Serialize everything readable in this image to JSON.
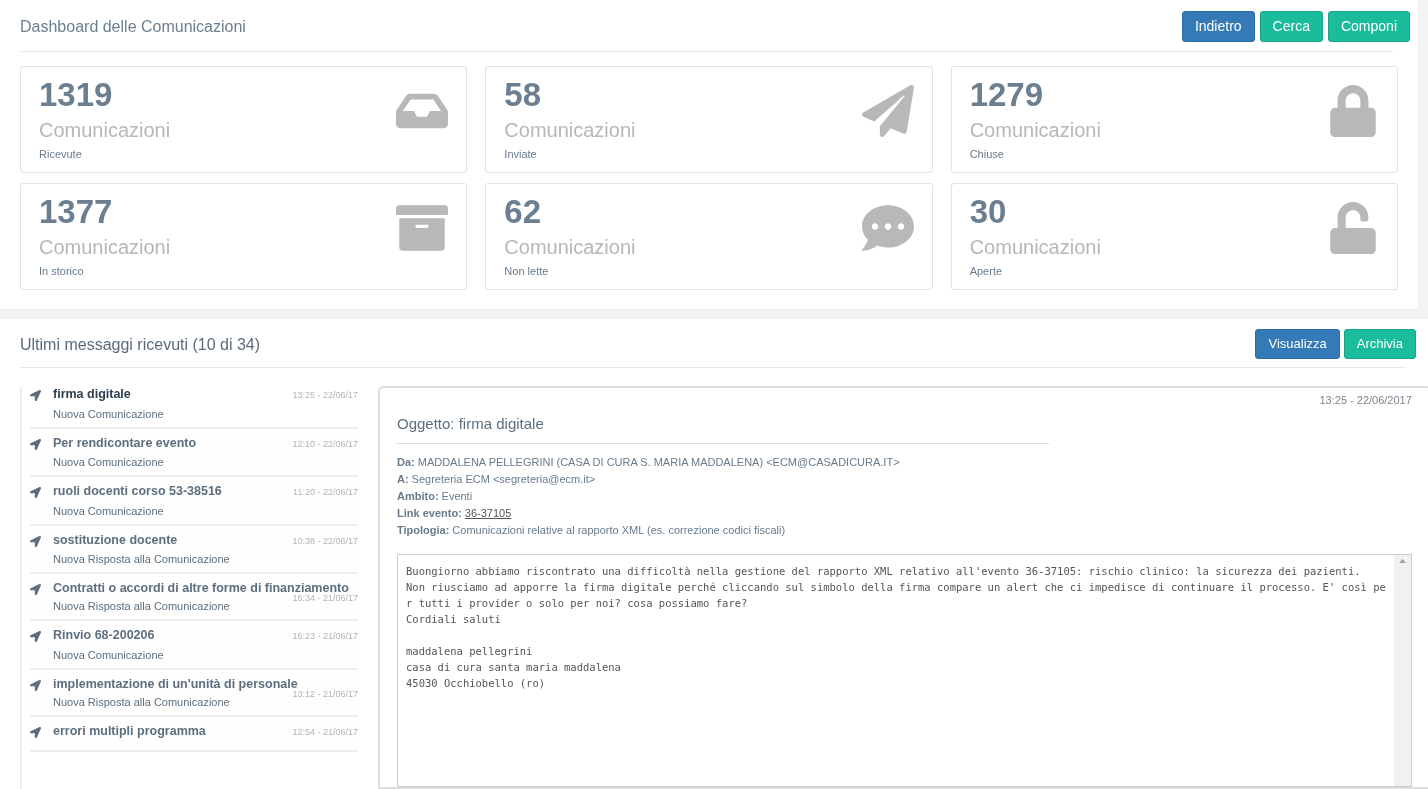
{
  "dashboard": {
    "title": "Dashboard delle Comunicazioni",
    "buttons": [
      {
        "label": "Indietro",
        "kind": "primary"
      },
      {
        "label": "Cerca",
        "kind": "success"
      },
      {
        "label": "Componi",
        "kind": "success"
      }
    ],
    "stats": [
      {
        "count": "1319",
        "label": "Comunicazioni",
        "caption": "Ricevute",
        "kind": "inbox"
      },
      {
        "count": "58",
        "label": "Comunicazioni",
        "caption": "Inviate",
        "kind": "sent"
      },
      {
        "count": "1279",
        "label": "Comunicazioni",
        "caption": "Chiuse",
        "kind": "closed"
      },
      {
        "count": "1377",
        "label": "Comunicazioni",
        "caption": "In storico",
        "kind": "archive"
      },
      {
        "count": "62",
        "label": "Comunicazioni",
        "caption": "Non lette",
        "kind": "unread"
      },
      {
        "count": "30",
        "label": "Comunicazioni",
        "caption": "Aperte",
        "kind": "open"
      }
    ]
  },
  "messages": {
    "title": "Ultimi messaggi ricevuti (10 di 34)",
    "buttons": [
      {
        "label": "Visualizza",
        "kind": "primary"
      },
      {
        "label": "Archivia",
        "kind": "success"
      }
    ],
    "items": [
      {
        "subject": "firma digitale",
        "type": "Nuova Comunicazione",
        "time": "13:25 - 22/06/17",
        "selected": true
      },
      {
        "subject": "Per rendicontare evento",
        "type": "Nuova Comunicazione",
        "time": "12:10 - 22/06/17",
        "selected": false
      },
      {
        "subject": "ruoli docenti corso 53-38516",
        "type": "Nuova Comunicazione",
        "time": "11:20 - 22/06/17",
        "selected": false
      },
      {
        "subject": "sostituzione docente",
        "type": "Nuova Risposta alla Comunicazione",
        "time": "10:38 - 22/06/17",
        "selected": false
      },
      {
        "subject": "Contratti o accordi di altre forme di finanziamento",
        "type": "Nuova Risposta alla Comunicazione",
        "time": "16:34 - 21/06/17",
        "selected": false
      },
      {
        "subject": "Rinvio 68-200206",
        "type": "Nuova Comunicazione",
        "time": "16:23 - 21/06/17",
        "selected": false
      },
      {
        "subject": "implementazione di un'unità di personale",
        "type": "Nuova Risposta alla Comunicazione",
        "time": "13:12 - 21/06/17",
        "selected": false
      },
      {
        "subject": "errori multipli programma",
        "time": "12:54 - 21/06/17",
        "selected": false
      }
    ],
    "detail": {
      "datetime": "13:25 - 22/06/2017",
      "subject": "Oggetto: firma digitale",
      "fields": [
        {
          "label": "Da:",
          "value": "MADDALENA PELLEGRINI (CASA DI CURA S. MARIA MADDALENA) <ECM@CASADICURA.IT>",
          "kind": "text"
        },
        {
          "label": "A:",
          "value": "Segreteria ECM <segreteria@ecm.it>",
          "kind": "text"
        },
        {
          "label": "Ambito:",
          "value": "Eventi",
          "kind": "text"
        },
        {
          "label": "Link evento:",
          "value": "36-37105",
          "kind": "link"
        },
        {
          "label": "Tipologia:",
          "value": "Comunicazioni relative al rapporto XML (es. correzione codici fiscali)",
          "kind": "text"
        }
      ],
      "body": [
        {
          "lines": [
            "Buongiorno abbiamo riscontrato una difficoltà nella gestione del rapporto XML relativo all'evento 36-37105: rischio clinico: la sicurezza dei pazienti.",
            "Non riusciamo ad apporre la firma digitale perché cliccando sul simbolo della firma compare un alert che ci impedisce di continuare il processo. E' così pe",
            "r tutti i provider o solo per noi? cosa possiamo fare?",
            "Cordiali saluti"
          ]
        },
        {
          "lines": [
            "maddalena pellegrini",
            "casa di cura santa maria maddalena",
            "45030 Occhiobello (ro)"
          ]
        }
      ]
    }
  }
}
